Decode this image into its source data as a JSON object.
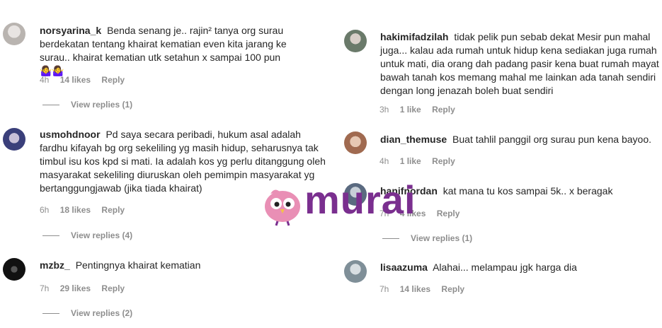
{
  "comments_left": [
    {
      "username": "norsyarina_k",
      "text": "Benda senang je.. rajin² tanya org surau berdekatan tentang khairat kematian even kita jarang ke surau.. khairat kematian utk setahun x sampai 100 pun 🤷‍♀️🤷‍♀️",
      "time": "4h",
      "likes": "14 likes",
      "reply": "Reply",
      "view_replies": "View replies (1)",
      "avatar_color": "#b9b4b0"
    },
    {
      "username": "usmohdnoor",
      "text": "Pd saya secara peribadi, hukum asal adalah fardhu kifayah bg org sekeliling yg masih hidup, seharusnya tak timbul isu kos kpd si mati. Ia adalah kos yg perlu ditanggung oleh masyarakat sekeliling diuruskan oleh pemimpin masyarakat yg bertanggungjawab (jika tiada khairat)",
      "time": "6h",
      "likes": "18 likes",
      "reply": "Reply",
      "view_replies": "View replies (4)",
      "avatar_color": "#3a3f7a"
    },
    {
      "username": "mzbz_",
      "text": "Pentingnya khairat kematian",
      "time": "7h",
      "likes": "29 likes",
      "reply": "Reply",
      "view_replies": "View replies (2)",
      "avatar_color": "#111111"
    }
  ],
  "comments_right": [
    {
      "username": "hakimifadzilah",
      "text": "tidak pelik pun sebab dekat Mesir pun mahal juga... kalau ada rumah untuk hidup kena sediakan juga rumah untuk mati, dia orang dah padang pasir kena buat rumah mayat bawah tanah kos memang mahal me lainkan ada tanah sendiri dengan long jenazah boleh buat sendiri",
      "time": "3h",
      "likes": "1 like",
      "reply": "Reply",
      "view_replies": "",
      "avatar_color": "#8a9a8a"
    },
    {
      "username": "dian_themuse",
      "text": "Buat tahlil panggil org surau pun kena bayoo.",
      "time": "4h",
      "likes": "1 like",
      "reply": "Reply",
      "view_replies": "",
      "avatar_color": "#c9a08a"
    },
    {
      "username": "hanifnordan",
      "text": "kat mana tu kos sampai 5k.. x beragak",
      "time": "7h",
      "likes": "4 likes",
      "reply": "Reply",
      "view_replies": "View replies (1)",
      "avatar_color": "#7a8aa0"
    },
    {
      "username": "lisaazuma",
      "text": "Alahai... melampau jgk harga dia",
      "time": "7h",
      "likes": "14 likes",
      "reply": "Reply",
      "view_replies": "",
      "avatar_color": "#9aa8b0"
    }
  ],
  "watermark": {
    "text": "murai",
    "color": "#7a2f8f",
    "bird_color": "#e98fb5"
  }
}
